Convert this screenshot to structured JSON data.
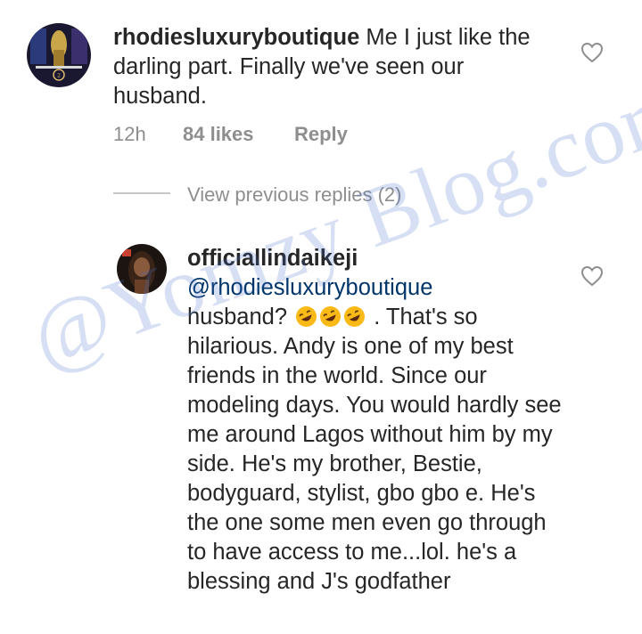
{
  "comment": {
    "username": "rhodiesluxuryboutique",
    "text": "Me I just like the darling part. Finally we've seen our husband.",
    "time": "12h",
    "likes": "84 likes",
    "reply": "Reply"
  },
  "view_previous": "View previous replies (2)",
  "reply_comment": {
    "username": "officiallindaikeji",
    "mention": "@rhodiesluxuryboutique",
    "text_line1_prefix": "husband?",
    "text_line1_suffix": ". That's so",
    "text_rest": "hilarious. Andy is one of my best friends in the world. Since our modeling days. You would hardly see me around Lagos without him by my side. He's my brother, Bestie, bodyguard, stylist, gbo gbo e. He's the one some men even go through to have access to me...lol. he's a blessing and J's godfather",
    "emoji_count": 3,
    "emoji_name": "rolling-on-floor-laughing"
  },
  "watermark": "@Yomzy Blog.com",
  "icons": {
    "like": "heart-outline-icon"
  }
}
